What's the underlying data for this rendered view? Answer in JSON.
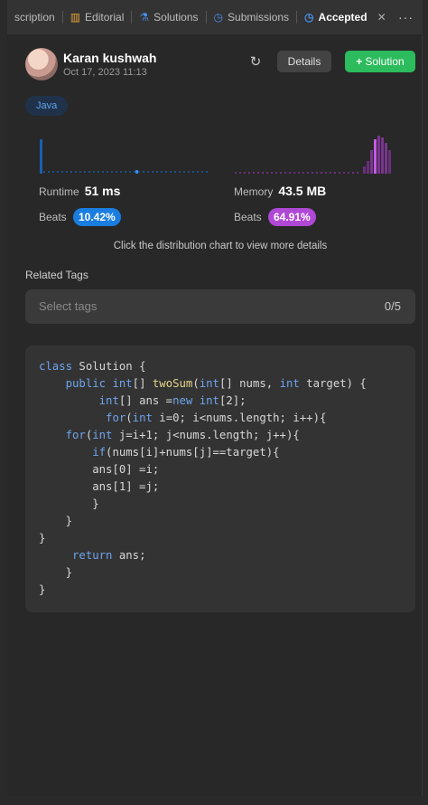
{
  "tabs": [
    {
      "label": "scription",
      "icon": ""
    },
    {
      "label": "Editorial",
      "icon": "book-icon"
    },
    {
      "label": "Solutions",
      "icon": "flask-icon"
    },
    {
      "label": "Submissions",
      "icon": "clock-icon"
    },
    {
      "label": "Accepted",
      "icon": "clock-icon"
    }
  ],
  "close_glyph": "✕",
  "more_glyph": "···",
  "submission": {
    "username": "Karan kushwah",
    "date": "Oct 17, 2023 11:13",
    "details_label": "Details",
    "solution_label": "Solution",
    "language": "Java"
  },
  "runtime": {
    "label": "Runtime",
    "value": "51 ms",
    "beats_label": "Beats",
    "beats": "10.42%"
  },
  "memory": {
    "label": "Memory",
    "value": "43.5 MB",
    "beats_label": "Beats",
    "beats": "64.91%"
  },
  "hint": "Click the distribution chart to view more details",
  "related_tags": {
    "title": "Related Tags",
    "placeholder": "Select tags",
    "count": "0/5"
  },
  "colors": {
    "accent_green": "#2cbb5d",
    "runtime_blue": "#1a7de0",
    "memory_purple": "#b048d6"
  }
}
